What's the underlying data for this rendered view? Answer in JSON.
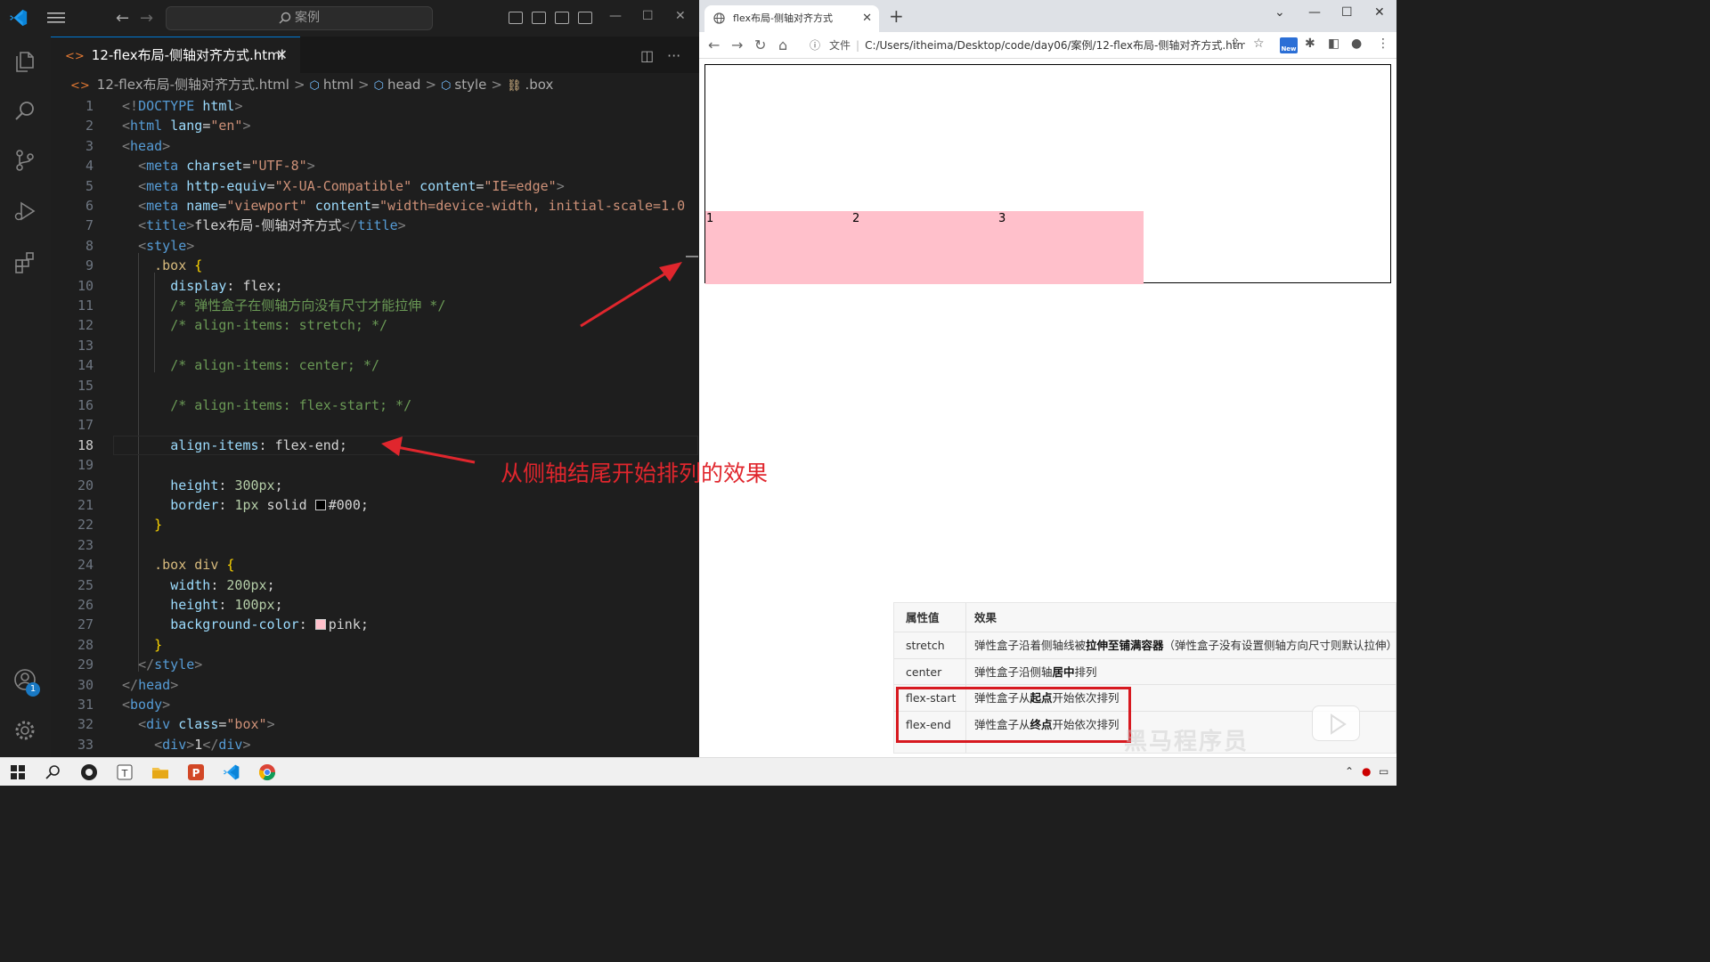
{
  "vscode": {
    "search_placeholder": "案例",
    "tab_label": "12-flex布局-侧轴对齐方式.html",
    "account_badge": "1",
    "breadcrumb": {
      "file": "12-flex布局-侧轴对齐方式.html",
      "html": "html",
      "head": "head",
      "style": "style",
      "box": ".box"
    },
    "active_line": "18"
  },
  "chrome": {
    "tab_title": "flex布局-侧轴对齐方式",
    "address_scheme": "文件",
    "address_url": "C:/Users/itheima/Desktop/code/day06/案例/12-flex布局-侧轴对齐方式.html",
    "new_badge": "New",
    "items": [
      "1",
      "2",
      "3"
    ],
    "table": {
      "header": {
        "key": "属性值",
        "value": "效果"
      },
      "rows": [
        {
          "key": "stretch",
          "pre": "弹性盒子沿着侧轴线被",
          "bold": "拉伸至铺满容器",
          "post": "（弹性盒子没有设置侧轴方向尺寸则默认拉伸）"
        },
        {
          "key": "center",
          "pre": "弹性盒子沿侧轴",
          "bold": "居中",
          "post": "排列"
        },
        {
          "key": "flex-start",
          "pre": "弹性盒子从",
          "bold": "起点",
          "post": "开始依次排列"
        },
        {
          "key": "flex-end",
          "pre": "弹性盒子从",
          "bold": "终点",
          "post": "开始依次排列"
        }
      ]
    },
    "watermark": "黑马程序员"
  },
  "annotation": "从侧轴结尾开始排列的效果",
  "colors": {
    "accent": "#0078d4",
    "annotation_red": "#e0262d",
    "pink": "#ffc0cb"
  }
}
